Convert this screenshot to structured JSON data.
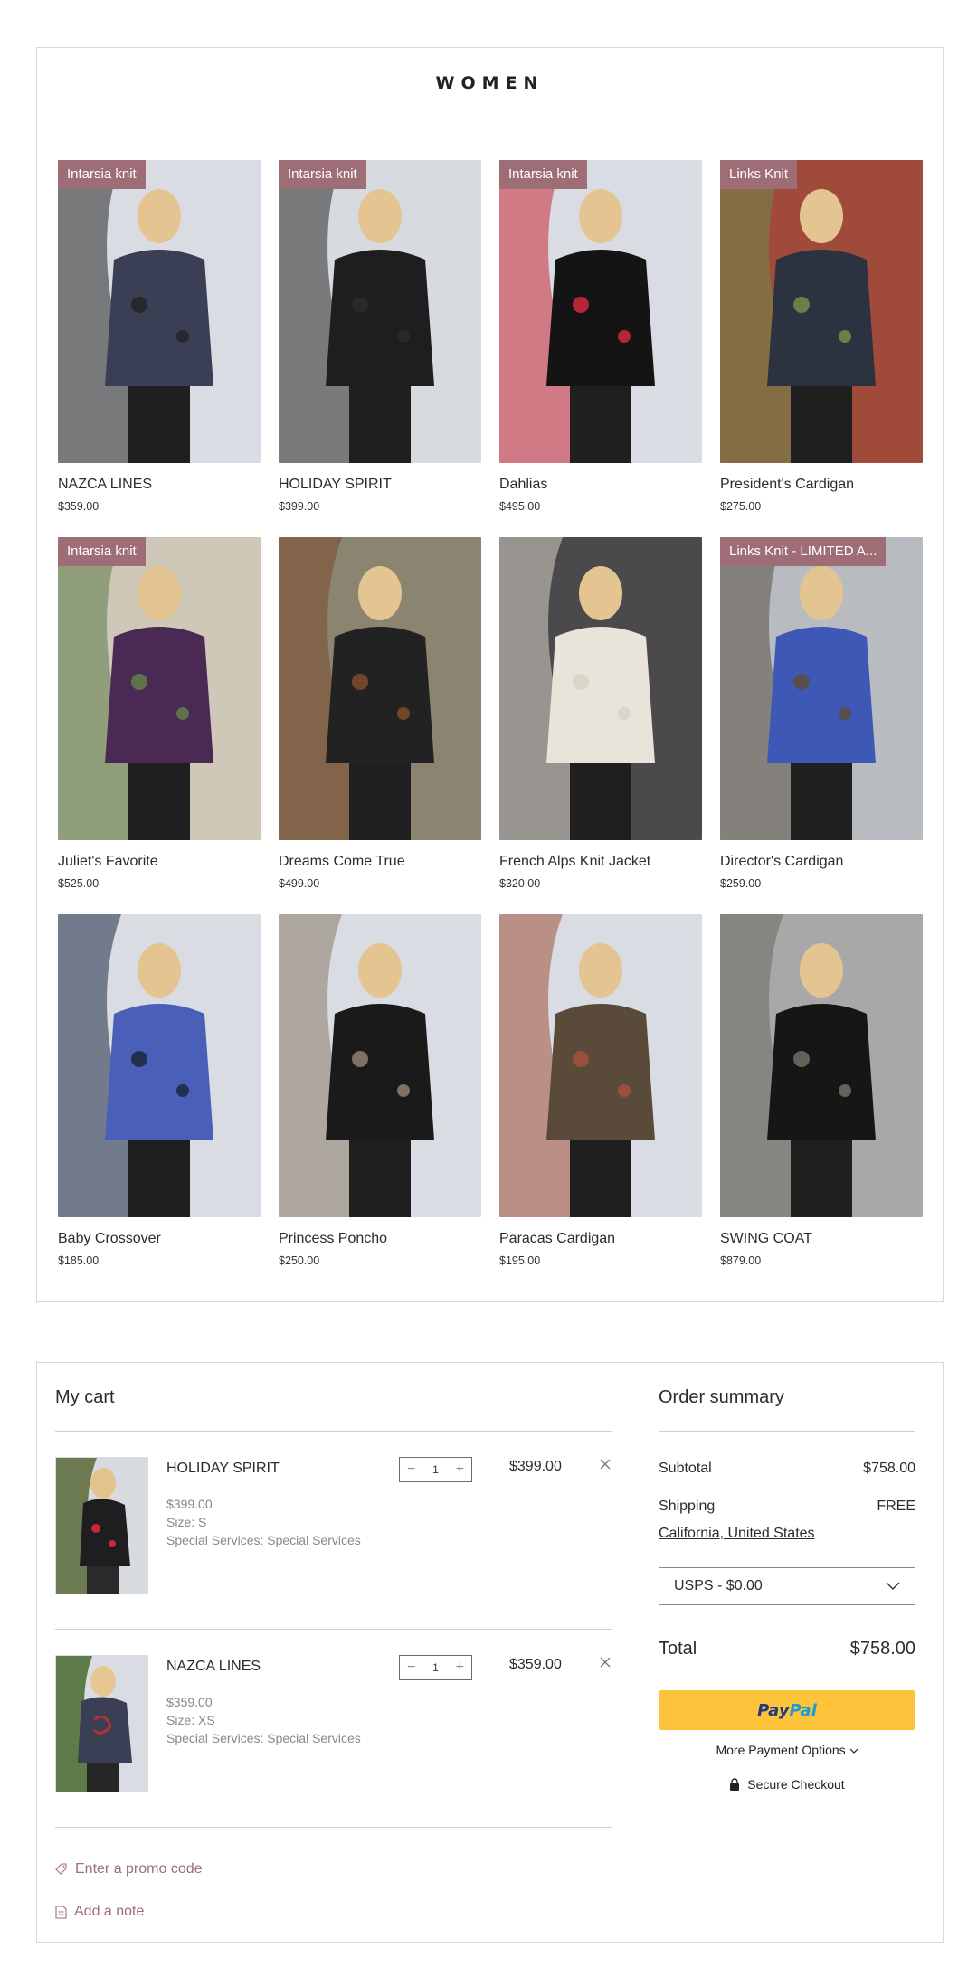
{
  "section": {
    "title": "WOMEN"
  },
  "products": [
    {
      "name": "NAZCA LINES",
      "price": "$359.00",
      "ribbon": "Intarsia knit",
      "bg": [
        "#d9dde3",
        "#3a3f55",
        "#262626"
      ]
    },
    {
      "name": "HOLIDAY SPIRIT",
      "price": "$399.00",
      "ribbon": "Intarsia knit",
      "bg": [
        "#d7dbe0",
        "#1e1e20",
        "#2a2a2a"
      ]
    },
    {
      "name": "Dahlias",
      "price": "$495.00",
      "ribbon": "Intarsia knit",
      "bg": [
        "#d9dde3",
        "#141414",
        "#c9283b"
      ]
    },
    {
      "name": "President's Cardigan",
      "price": "$275.00",
      "ribbon": "Links Knit",
      "bg": [
        "#a04a3a",
        "#2c3240",
        "#6e8a4a"
      ]
    },
    {
      "name": "Juliet's Favorite",
      "price": "$525.00",
      "ribbon": "Intarsia knit",
      "bg": [
        "#cfc8b8",
        "#4a2a55",
        "#5e7b4a"
      ]
    },
    {
      "name": "Dreams Come True",
      "price": "$499.00",
      "ribbon": "",
      "bg": [
        "#8a8470",
        "#222222",
        "#7a4a2a"
      ]
    },
    {
      "name": "French Alps Knit Jacket",
      "price": "$320.00",
      "ribbon": "",
      "bg": [
        "#4a4a4c",
        "#e8e4da",
        "#d8d2c6"
      ]
    },
    {
      "name": "Director's Cardigan",
      "price": "$259.00",
      "ribbon": "Links Knit - LIMITED A...",
      "bg": [
        "#b8bcc0",
        "#3e58b5",
        "#5a4e44"
      ]
    },
    {
      "name": "Baby Crossover",
      "price": "$185.00",
      "ribbon": "",
      "bg": [
        "#d9dde3",
        "#4a5fb8",
        "#1e2a44"
      ]
    },
    {
      "name": "Princess Poncho",
      "price": "$250.00",
      "ribbon": "",
      "bg": [
        "#d9dde3",
        "#1a1a1a",
        "#8a7a6a"
      ]
    },
    {
      "name": "Paracas Cardigan",
      "price": "$195.00",
      "ribbon": "",
      "bg": [
        "#d9dde3",
        "#5a4a3a",
        "#a0503a"
      ]
    },
    {
      "name": "SWING COAT",
      "price": "$879.00",
      "ribbon": "",
      "bg": [
        "#a8a8a8",
        "#161616",
        "#6a6a60"
      ]
    }
  ],
  "cart": {
    "title": "My cart",
    "items": [
      {
        "name": "HOLIDAY SPIRIT",
        "unit_price": "$399.00",
        "size": "Size: S",
        "services": "Special Services: Special Services",
        "qty": "1",
        "price": "$399.00"
      },
      {
        "name": "NAZCA LINES",
        "unit_price": "$359.00",
        "size": "Size: XS",
        "services": "Special Services: Special Services",
        "qty": "1",
        "price": "$359.00"
      }
    ],
    "promo": "Enter a promo code",
    "note": "Add a note"
  },
  "summary": {
    "title": "Order summary",
    "subtotal_label": "Subtotal",
    "subtotal": "$758.00",
    "shipping_label": "Shipping",
    "shipping": "FREE",
    "location": "California, United States",
    "method": "USPS - $0.00",
    "total_label": "Total",
    "total": "$758.00",
    "paypal_a": "Pay",
    "paypal_b": "Pal",
    "more_payment": "More Payment Options",
    "secure": "Secure Checkout"
  },
  "colors": {
    "accent": "#9e6d76",
    "paypal": "#fdc43b"
  }
}
